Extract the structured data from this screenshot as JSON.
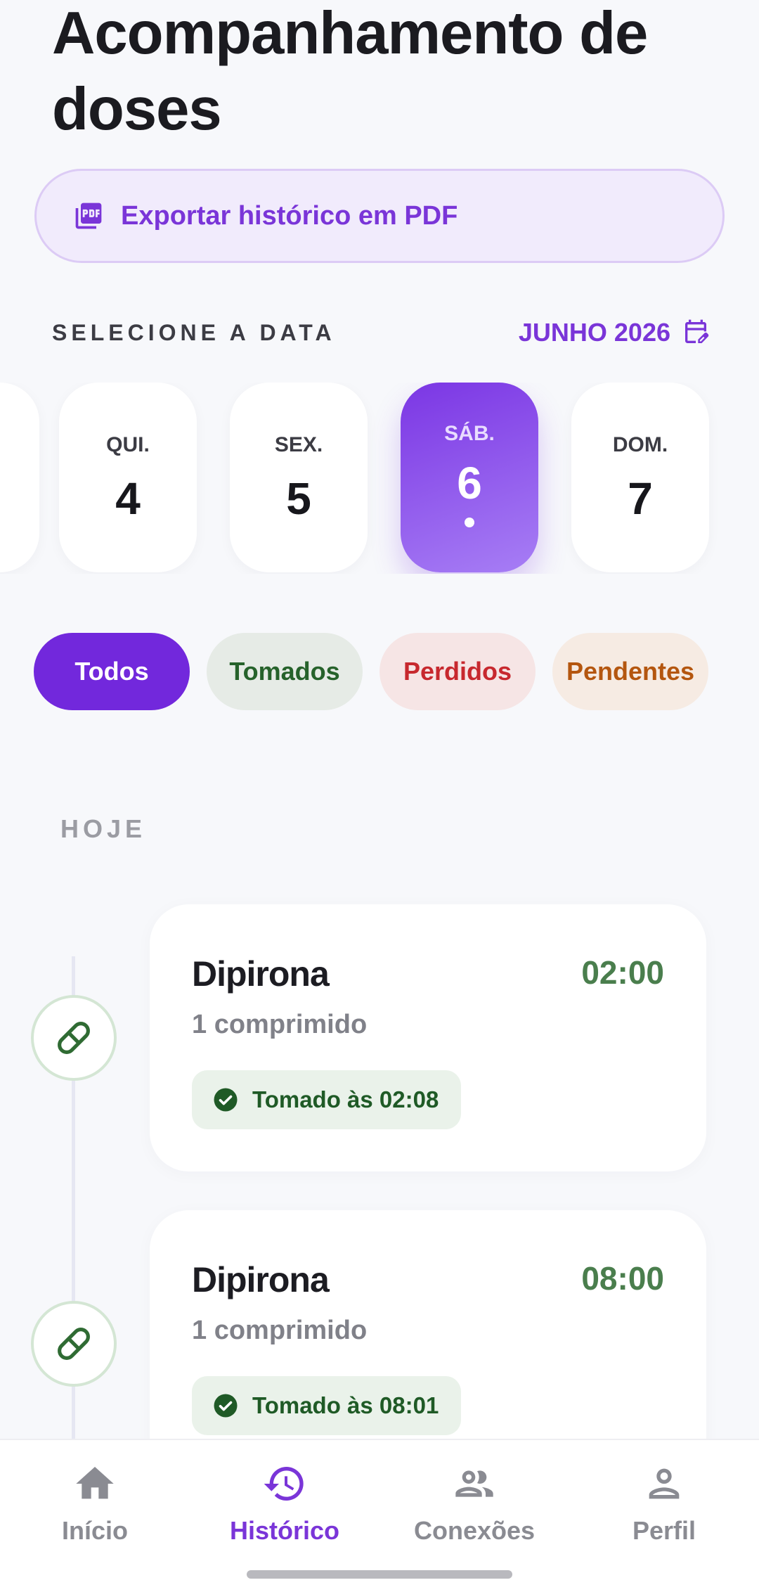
{
  "page": {
    "title": "Acompanhamento de doses"
  },
  "export": {
    "label": "Exportar histórico em PDF",
    "icon": "pdf-icon"
  },
  "date_picker": {
    "heading": "SELECIONE A DATA",
    "month": "JUNHO 2026",
    "days": [
      {
        "weekday": "QUI.",
        "day": "4",
        "selected": false
      },
      {
        "weekday": "SEX.",
        "day": "5",
        "selected": false
      },
      {
        "weekday": "SÁB.",
        "day": "6",
        "selected": true
      },
      {
        "weekday": "DOM.",
        "day": "7",
        "selected": false
      }
    ]
  },
  "filters": [
    {
      "label": "Todos",
      "active": true
    },
    {
      "label": "Tomados",
      "active": false
    },
    {
      "label": "Perdidos",
      "active": false
    },
    {
      "label": "Pendentes",
      "active": false
    }
  ],
  "section": {
    "label": "HOJE"
  },
  "doses": [
    {
      "name": "Dipirona",
      "time": "02:00",
      "quantity": "1 comprimido",
      "status": "Tomado às 02:08"
    },
    {
      "name": "Dipirona",
      "time": "08:00",
      "quantity": "1 comprimido",
      "status": "Tomado às 08:01"
    }
  ],
  "nav": {
    "items": [
      {
        "label": "Início",
        "icon": "home-icon"
      },
      {
        "label": "Histórico",
        "icon": "history-icon",
        "active": true
      },
      {
        "label": "Conexões",
        "icon": "people-icon"
      },
      {
        "label": "Perfil",
        "icon": "person-icon"
      }
    ]
  },
  "colors": {
    "accent": "#7a35d8",
    "taken": "#26622b",
    "missed": "#c7282e",
    "pending": "#b4560f"
  }
}
